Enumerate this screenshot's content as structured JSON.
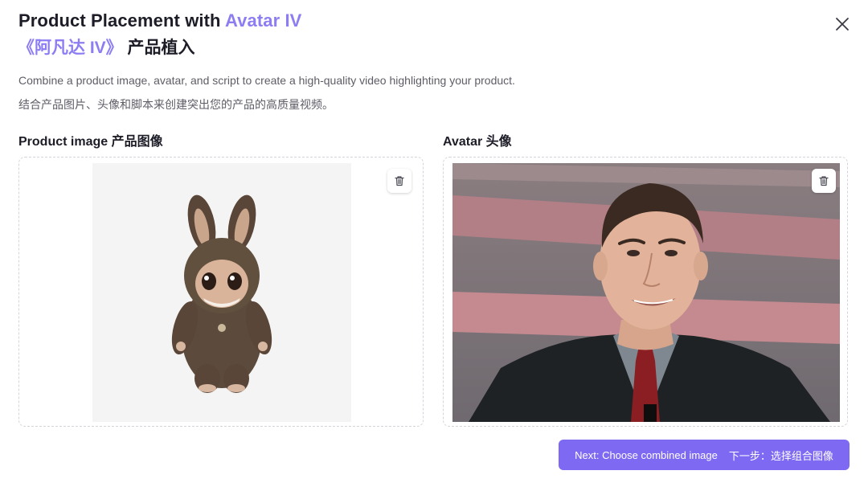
{
  "header": {
    "title_prefix": "Product Placement with ",
    "title_accent": "Avatar IV",
    "subtitle_accent": "《阿凡达 IV》",
    "subtitle_rest": " 产品植入"
  },
  "description": {
    "en": "Combine a product image, avatar, and script to create a high-quality video highlighting your product.",
    "zh": "结合产品图片、头像和脚本来创建突出您的产品的高质量视频。"
  },
  "product": {
    "label": "Product image  产品图像"
  },
  "avatar": {
    "label": "Avatar  头像"
  },
  "next_button": {
    "label_en": "Next: Choose combined image",
    "label_zh": "下一步：选择组合图像"
  },
  "colors": {
    "accent": "#8c7df3",
    "button": "#7e69f2"
  },
  "icons": {
    "close": "close-icon",
    "delete": "trash-icon"
  }
}
